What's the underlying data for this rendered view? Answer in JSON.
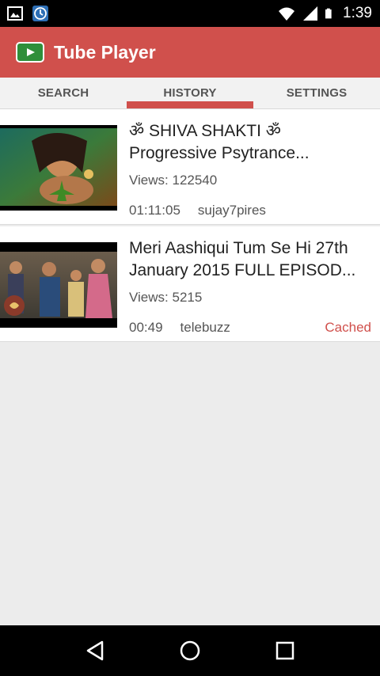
{
  "status_bar": {
    "time": "1:39",
    "icons": [
      "image-icon",
      "clock-app-icon",
      "wifi-icon",
      "signal-icon",
      "battery-icon"
    ]
  },
  "app_bar": {
    "title": "Tube Player",
    "logo_icon": "tube-player-logo-icon",
    "color": "#d0504c"
  },
  "tabs": [
    {
      "label": "SEARCH",
      "selected": false
    },
    {
      "label": "HISTORY",
      "selected": true
    },
    {
      "label": "SETTINGS",
      "selected": false
    }
  ],
  "videos": [
    {
      "title_line1": "ॐ SHIVA SHAKTI ॐ",
      "title_line2": "Progressive Psytrance...",
      "views": "Views: 122540",
      "duration": "01:11:05",
      "channel": "sujay7pires",
      "badge": ""
    },
    {
      "title_line1": "Meri Aashiqui Tum Se Hi 27th",
      "title_line2": "January 2015 FULL EPISOD...",
      "views": "Views: 5215",
      "duration": "00:49",
      "channel": "telebuzz",
      "badge": "Cached"
    }
  ],
  "nav_bar": {
    "icons": [
      "back-icon",
      "home-icon",
      "recents-icon"
    ]
  }
}
